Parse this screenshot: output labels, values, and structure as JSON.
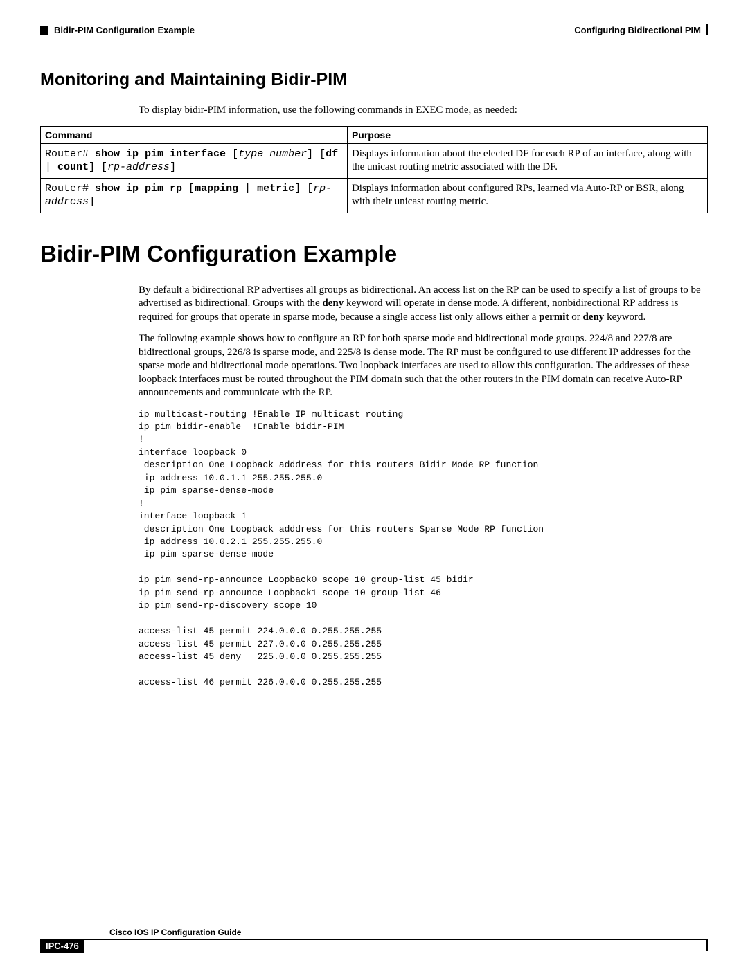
{
  "header": {
    "left_section": "Bidir-PIM Configuration Example",
    "right_doc": "Configuring Bidirectional PIM"
  },
  "section1": {
    "title": "Monitoring and Maintaining Bidir-PIM",
    "intro": "To display bidir-PIM information, use the following commands in EXEC mode, as needed:"
  },
  "table": {
    "th_cmd": "Command",
    "th_purpose": "Purpose",
    "r1_cmd_html": "Router# <b>show ip pim interface</b> [<i>type number</i>] [<b>df</b> | <b>count</b>] [<i>rp-address</i>]",
    "r1_purpose": "Displays information about the elected DF for each RP of an interface, along with the unicast routing metric associated with the DF.",
    "r2_cmd_html": "Router# <b>show ip pim rp</b> [<b>mapping</b> | <b>metric</b>] [<i>rp-address</i>]",
    "r2_purpose": "Displays information about configured RPs, learned via Auto-RP or BSR, along with their unicast routing metric."
  },
  "section2": {
    "title": "Bidir-PIM Configuration Example",
    "p1_html": "By default a bidirectional RP advertises all groups as bidirectional. An access list on the RP can be used to specify a list of groups to be advertised as bidirectional. Groups with the <b>deny</b> keyword will operate in dense mode. A different, nonbidirectional RP address is required for groups that operate in sparse mode, because a single access list only allows either a <b>permit</b> or <b>deny</b> keyword.",
    "p2": "The following example shows how to configure an RP for both sparse mode and bidirectional mode groups. 224/8 and 227/8 are bidirectional groups, 226/8 is sparse mode, and 225/8 is dense mode. The RP must be configured to use different IP addresses for the sparse mode and bidirectional mode operations. Two loopback interfaces are used to allow this configuration. The addresses of these loopback interfaces must be routed throughout the PIM domain such that the other routers in the PIM domain can receive Auto-RP announcements and communicate with the RP.",
    "code": "ip multicast-routing !Enable IP multicast routing\nip pim bidir-enable  !Enable bidir-PIM\n!\ninterface loopback 0\n description One Loopback adddress for this routers Bidir Mode RP function\n ip address 10.0.1.1 255.255.255.0\n ip pim sparse-dense-mode\n!\ninterface loopback 1\n description One Loopback adddress for this routers Sparse Mode RP function\n ip address 10.0.2.1 255.255.255.0\n ip pim sparse-dense-mode\n\nip pim send-rp-announce Loopback0 scope 10 group-list 45 bidir\nip pim send-rp-announce Loopback1 scope 10 group-list 46\nip pim send-rp-discovery scope 10\n\naccess-list 45 permit 224.0.0.0 0.255.255.255\naccess-list 45 permit 227.0.0.0 0.255.255.255\naccess-list 45 deny   225.0.0.0 0.255.255.255\n\naccess-list 46 permit 226.0.0.0 0.255.255.255"
  },
  "footer": {
    "title": "Cisco IOS IP Configuration Guide",
    "page": "IPC-476"
  }
}
